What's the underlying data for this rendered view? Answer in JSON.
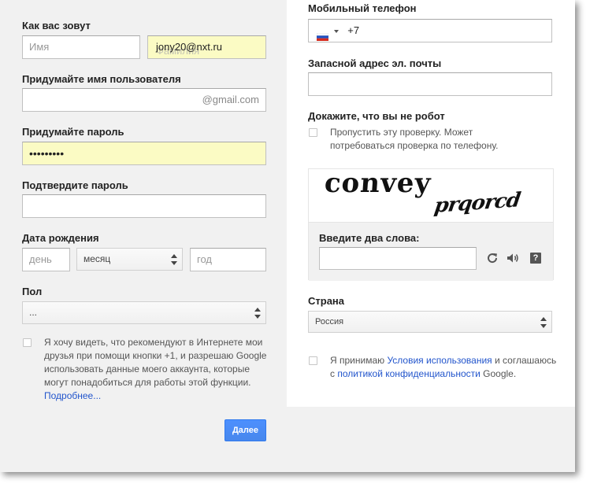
{
  "left": {
    "name_label": "Как вас зовут",
    "first_name_placeholder": "Имя",
    "last_name_value": "jony20@nxt.ru",
    "last_name_overlay": "Фамилия",
    "username_label": "Придумайте имя пользователя",
    "username_suffix": "@gmail.com",
    "password_label": "Придумайте пароль",
    "password_value": "•••••••••",
    "confirm_label": "Подтвердите пароль",
    "birthday_label": "Дата рождения",
    "day_placeholder": "день",
    "month_value": "месяц",
    "year_placeholder": "год",
    "gender_label": "Пол",
    "gender_value": "...",
    "plusone_text": "Я хочу видеть, что рекомендуют в Интернете мои друзья при помощи кнопки +1, и разрешаю Google использовать данные моего аккаунта, которые могут понадобиться для работы этой функции.",
    "plusone_link": "Подробнее...",
    "next_button": "Далее"
  },
  "right": {
    "phone_label": "Мобильный телефон",
    "phone_value": "+7",
    "flag_icon": "russia-flag-icon",
    "email_label": "Запасной адрес эл. почты",
    "robot_label": "Докажите, что вы не робот",
    "skip_text": "Пропустить эту проверку. Может потребоваться проверка по телефону.",
    "captcha_word1": "convey",
    "captcha_word2": "prqorcd",
    "captcha_prompt": "Введите два слова:",
    "icons": [
      "refresh-icon",
      "audio-icon",
      "help-icon"
    ],
    "help_glyph": "?",
    "country_label": "Страна",
    "country_value": "Россия",
    "terms_prefix": "Я принимаю ",
    "terms_link": "Условия использования",
    "terms_middle": " и соглашаюсь с ",
    "privacy_link": "политикой конфиденциальности",
    "terms_suffix": " Google."
  },
  "colors": {
    "accent": "#4d90fe",
    "link": "#2255cc",
    "autofill": "#fbfbc4",
    "background": "#f1f1f1"
  }
}
